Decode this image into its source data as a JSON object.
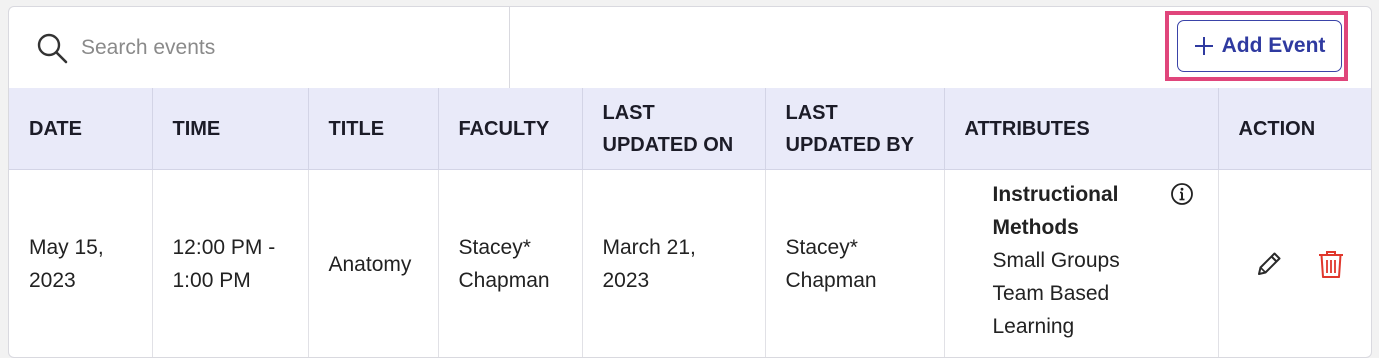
{
  "search": {
    "placeholder": "Search events"
  },
  "toolbar": {
    "add_label": "Add Event"
  },
  "table": {
    "headers": {
      "date": "DATE",
      "time": "TIME",
      "title": "TITLE",
      "faculty": "FACULTY",
      "last_updated_on_1": "LAST",
      "last_updated_on_2": "UPDATED ON",
      "last_updated_by_1": "LAST",
      "last_updated_by_2": "UPDATED BY",
      "attributes": "ATTRIBUTES",
      "action": "ACTION"
    },
    "rows": [
      {
        "date_1": "May 15,",
        "date_2": "2023",
        "time_1": "12:00 PM -",
        "time_2": "1:00 PM",
        "title": "Anatomy",
        "faculty_1": "Stacey*",
        "faculty_2": "Chapman",
        "updated_on_1": "March 21,",
        "updated_on_2": "2023",
        "updated_by_1": "Stacey*",
        "updated_by_2": "Chapman",
        "attribute_heading": "Instructional Methods",
        "attribute_values": [
          "Small Groups",
          "Team Based",
          "Learning"
        ]
      }
    ]
  },
  "colors": {
    "header_bg": "#e9eaf9",
    "accent": "#2f3aa0",
    "highlight": "#e0457b",
    "delete": "#e0372c"
  },
  "icons": [
    "search-icon",
    "plus-icon",
    "info-icon",
    "pencil-icon",
    "trash-icon"
  ]
}
